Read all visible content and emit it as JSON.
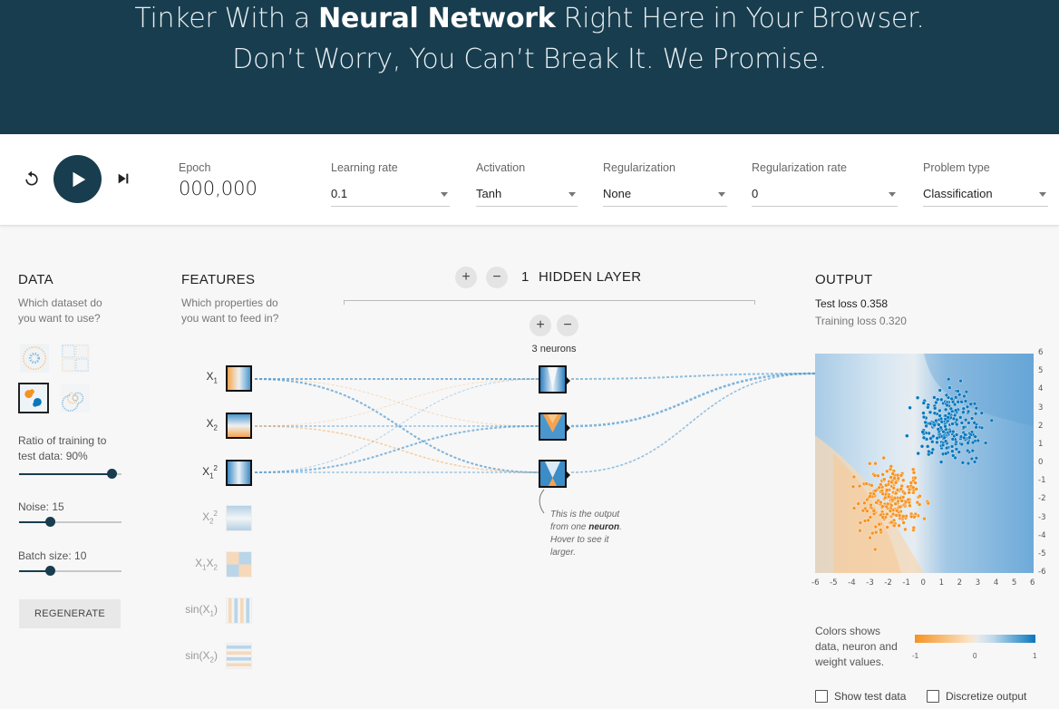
{
  "header": {
    "line1_pre": "Tinker With a ",
    "line1_bold": "Neural Network",
    "line1_post": " Right Here in Your Browser.",
    "line2": "Don’t Worry, You Can’t Break It. We Promise."
  },
  "controls": {
    "reset_icon": "reset-icon",
    "play_icon": "play-icon",
    "step_icon": "step-forward-icon",
    "epoch_label": "Epoch",
    "epoch_value": "000,000",
    "learning_rate_label": "Learning rate",
    "learning_rate_value": "0.1",
    "activation_label": "Activation",
    "activation_value": "Tanh",
    "regularization_label": "Regularization",
    "regularization_value": "None",
    "regularization_rate_label": "Regularization rate",
    "regularization_rate_value": "0",
    "problem_type_label": "Problem type",
    "problem_type_value": "Classification"
  },
  "data_panel": {
    "title": "DATA",
    "subtitle_1": "Which dataset do",
    "subtitle_2": "you want to use?",
    "datasets": [
      "circle",
      "xor",
      "gaussian",
      "spiral"
    ],
    "selected_dataset": "gaussian",
    "ratio_label_1": "Ratio of training to",
    "ratio_label_2": "test data:  90%",
    "ratio_value": 0.9,
    "noise_label": "Noise:  15",
    "noise_value": 0.3,
    "batch_label": "Batch size:  10",
    "batch_value": 0.3,
    "regenerate_label": "REGENERATE"
  },
  "features_panel": {
    "title": "FEATURES",
    "subtitle_1": "Which properties do",
    "subtitle_2": "you want to feed in?",
    "features": [
      {
        "label": "X",
        "sub": "1",
        "sup": "",
        "active": true
      },
      {
        "label": "X",
        "sub": "2",
        "sup": "",
        "active": true
      },
      {
        "label": "X",
        "sub": "1",
        "sup": "2",
        "active": true
      },
      {
        "label": "X",
        "sub": "2",
        "sup": "2",
        "active": false
      },
      {
        "label": "X",
        "sub": "1",
        "sup": "",
        "label2": "X",
        "sub2": "2",
        "active": false
      },
      {
        "label": "sin(X",
        "sub": "1",
        "sup": "",
        "tail": ")",
        "active": false
      },
      {
        "label": "sin(X",
        "sub": "2",
        "sup": "",
        "tail": ")",
        "active": false
      }
    ]
  },
  "hidden_layers": {
    "add_label": "+",
    "remove_label": "−",
    "count": "1",
    "label": "HIDDEN LAYER",
    "neurons_label": "3 neurons",
    "neuron_note_1": "This is the output",
    "neuron_note_2_pre": "from one ",
    "neuron_note_2_bold": "neuron",
    "neuron_note_2_post": ".",
    "neuron_note_3": "Hover to see it",
    "neuron_note_4": "larger."
  },
  "output_panel": {
    "title": "OUTPUT",
    "test_loss": "Test loss 0.358",
    "training_loss": "Training loss 0.320",
    "x_ticks": [
      "-6",
      "-5",
      "-4",
      "-3",
      "-2",
      "-1",
      "0",
      "1",
      "2",
      "3",
      "4",
      "5",
      "6"
    ],
    "y_ticks": [
      "6",
      "5",
      "4",
      "3",
      "2",
      "1",
      "0",
      "-1",
      "-2",
      "-3",
      "-4",
      "-5",
      "-6"
    ],
    "legend_1": "Colors shows",
    "legend_2": "data, neuron and",
    "legend_3": "weight values.",
    "legend_min": "-1",
    "legend_mid": "0",
    "legend_max": "1",
    "show_test_label": "Show test data",
    "discretize_label": "Discretize output"
  },
  "colors": {
    "dark": "#183d4e",
    "orange": "#f59322",
    "blue": "#0877bd"
  }
}
